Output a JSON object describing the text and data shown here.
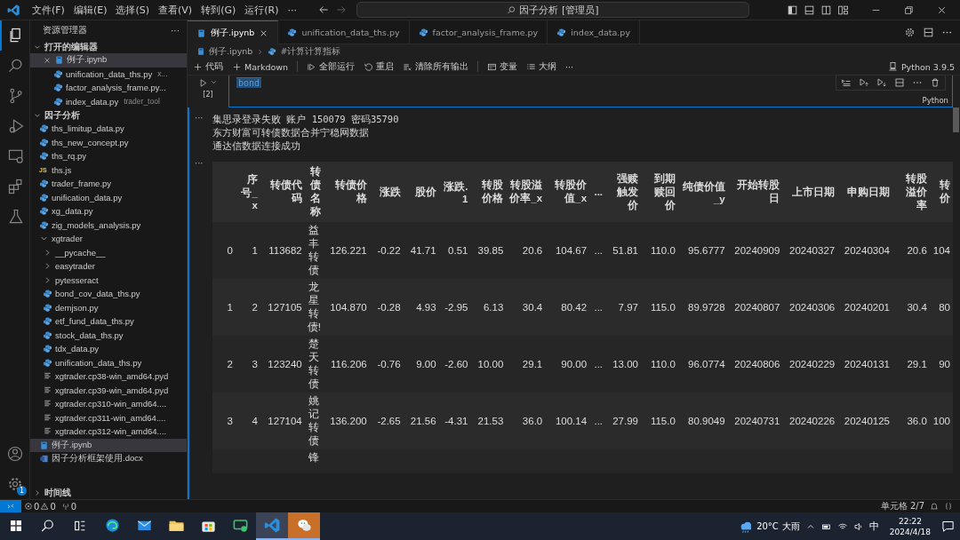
{
  "titlebar": {
    "menus": [
      "文件(F)",
      "编辑(E)",
      "选择(S)",
      "查看(V)",
      "转到(G)",
      "运行(R)",
      "···"
    ],
    "search": "因子分析 [管理员]"
  },
  "activity_bar": {
    "items": [
      {
        "kind": "explorer",
        "selected": true
      },
      {
        "kind": "search",
        "selected": false
      },
      {
        "kind": "source-control",
        "selected": false
      },
      {
        "kind": "run-debug",
        "selected": false
      },
      {
        "kind": "remote",
        "selected": false
      },
      {
        "kind": "extensions",
        "selected": false
      },
      {
        "kind": "testing",
        "selected": false
      }
    ],
    "settings_badge": "1"
  },
  "sidebar": {
    "title": "资源管理器",
    "more": "···",
    "open_editors": {
      "title": "打开的编辑器",
      "expanded": true,
      "items": [
        {
          "name": "例子.ipynb",
          "kind": "notebook",
          "selected": true
        },
        {
          "name": "unification_data_ths.py",
          "detail": "x...",
          "kind": "py",
          "selected": false
        },
        {
          "name": "factor_analysis_frame.py...",
          "kind": "py",
          "selected": false
        },
        {
          "name": "index_data.py",
          "detail": "trader_tool",
          "kind": "py",
          "selected": false
        }
      ]
    },
    "project": {
      "title": "因子分析",
      "expanded": true,
      "items": [
        {
          "name": "ths_limitup_data.py",
          "kind": "py",
          "selected": false
        },
        {
          "name": "ths_new_concept.py",
          "kind": "py",
          "selected": false
        },
        {
          "name": "ths_rq.py",
          "kind": "py",
          "selected": false
        },
        {
          "name": "ths.js",
          "kind": "js",
          "icon_text": "JS",
          "selected": false
        },
        {
          "name": "trader_frame.py",
          "kind": "py",
          "selected": false
        },
        {
          "name": "unification_data.py",
          "kind": "py",
          "selected": false
        },
        {
          "name": "xg_data.py",
          "kind": "py",
          "selected": false
        },
        {
          "name": "zig_models_analysis.py",
          "kind": "py",
          "selected": false
        },
        {
          "name": "xgtrader",
          "kind": "folder",
          "expanded": true,
          "selected": false,
          "children": [
            {
              "name": "__pycache__",
              "kind": "folder",
              "expanded": false,
              "selected": false
            },
            {
              "name": "easytrader",
              "kind": "folder",
              "expanded": false,
              "selected": false
            },
            {
              "name": "pytesseract",
              "kind": "folder",
              "expanded": false,
              "selected": false
            },
            {
              "name": "bond_cov_data_ths.py",
              "kind": "py",
              "selected": false
            },
            {
              "name": "demjson.py",
              "kind": "py",
              "selected": false
            },
            {
              "name": "etf_fund_data_ths.py",
              "kind": "py",
              "selected": false
            },
            {
              "name": "stock_data_ths.py",
              "kind": "py",
              "selected": false
            },
            {
              "name": "tdx_data.py",
              "kind": "py",
              "selected": false
            },
            {
              "name": "unification_data_ths.py",
              "kind": "py",
              "selected": false
            },
            {
              "name": "xgtrader.cp38-win_amd64.pyd",
              "kind": "binary",
              "selected": false
            },
            {
              "name": "xgtrader.cp39-win_amd64.pyd",
              "kind": "binary",
              "selected": false
            },
            {
              "name": "xgtrader.cp310-win_amd64....",
              "kind": "binary",
              "selected": false
            },
            {
              "name": "xgtrader.cp311-win_amd64....",
              "kind": "binary",
              "selected": false
            },
            {
              "name": "xgtrader.cp312-win_amd64....",
              "kind": "binary",
              "selected": false
            }
          ]
        },
        {
          "name": "例子.ipynb",
          "kind": "notebook",
          "selected": true
        },
        {
          "name": "因子分析框架使用.docx",
          "kind": "docx",
          "selected": false
        }
      ]
    },
    "timeline": {
      "title": "时间线",
      "expanded": false
    }
  },
  "tabs": [
    {
      "label": "例子.ipynb",
      "kind": "notebook",
      "selected": true
    },
    {
      "label": "unification_data_ths.py",
      "kind": "py",
      "selected": false
    },
    {
      "label": "factor_analysis_frame.py",
      "kind": "py",
      "selected": false
    },
    {
      "label": "index_data.py",
      "kind": "py",
      "selected": false
    }
  ],
  "breadcrumb": [
    "例子.ipynb",
    "#计算计算指标"
  ],
  "toolbar": {
    "items": [
      "代码",
      "Markdown",
      "全部运行",
      "重启",
      "清除所有输出",
      "变量",
      "大纲",
      "···"
    ],
    "kernel": "Python 3.9.5"
  },
  "cell": {
    "run_count": "[2]",
    "code": "bond",
    "language": "Python"
  },
  "output": {
    "menu": "···",
    "lines": [
      "集思录登录失败 账户 150079 密码35790",
      "东方财富可转债数据合并宁稳网数据",
      "通达信数据连接成功"
    ]
  },
  "table": {
    "menu": "···",
    "columns": [
      "序号_x",
      "转债代码",
      "转债名称",
      "转债价格",
      "涨跌",
      "股价",
      "涨跌.1",
      "转股价格",
      "转股溢价率_x",
      "转股价值_x",
      "...",
      "强赎触发价",
      "到期赎回价",
      "纯债价值_y",
      "开始转股日",
      "上市日期",
      "申购日期",
      "转股溢价率",
      "转价"
    ],
    "rows": [
      {
        "index": "0",
        "cells": [
          "1",
          "113682",
          "益丰转债",
          "126.221",
          "-0.22",
          "41.71",
          "0.51",
          "39.85",
          "20.6",
          "104.67",
          "...",
          "51.81",
          "110.0",
          "95.6777",
          "20240909",
          "20240327",
          "20240304",
          "20.6",
          "104"
        ]
      },
      {
        "index": "1",
        "cells": [
          "2",
          "127105",
          "龙星转债!",
          "104.870",
          "-0.28",
          "4.93",
          "-2.95",
          "6.13",
          "30.4",
          "80.42",
          "...",
          "7.97",
          "115.0",
          "89.9728",
          "20240807",
          "20240306",
          "20240201",
          "30.4",
          "80"
        ]
      },
      {
        "index": "2",
        "cells": [
          "3",
          "123240",
          "楚天转债",
          "116.206",
          "-0.76",
          "9.00",
          "-2.60",
          "10.00",
          "29.1",
          "90.00",
          "...",
          "13.00",
          "110.0",
          "96.0774",
          "20240806",
          "20240229",
          "20240131",
          "29.1",
          "90"
        ]
      },
      {
        "index": "3",
        "cells": [
          "4",
          "127104",
          "姚记转债",
          "136.200",
          "-2.65",
          "21.56",
          "-4.31",
          "21.53",
          "36.0",
          "100.14",
          "...",
          "27.99",
          "115.0",
          "80.9049",
          "20240731",
          "20240226",
          "20240125",
          "36.0",
          "100"
        ]
      }
    ],
    "cut_row_name": "锋"
  },
  "status_bar": {
    "errors": "0",
    "warnings": "0",
    "ports": "0",
    "cell_position": "单元格 2/7"
  },
  "taskbar": {
    "apps": [
      {
        "kind": "edge",
        "active": false
      },
      {
        "kind": "mail",
        "active": false
      },
      {
        "kind": "folder",
        "active": false
      },
      {
        "kind": "store",
        "active": false
      },
      {
        "kind": "monitor",
        "active": false
      },
      {
        "kind": "vscode",
        "active": true
      },
      {
        "kind": "wechat",
        "active": true
      }
    ],
    "weather": "20°C",
    "weather_text": "大雨",
    "ime": "中",
    "time": "22:22",
    "date": "2024/4/18"
  }
}
